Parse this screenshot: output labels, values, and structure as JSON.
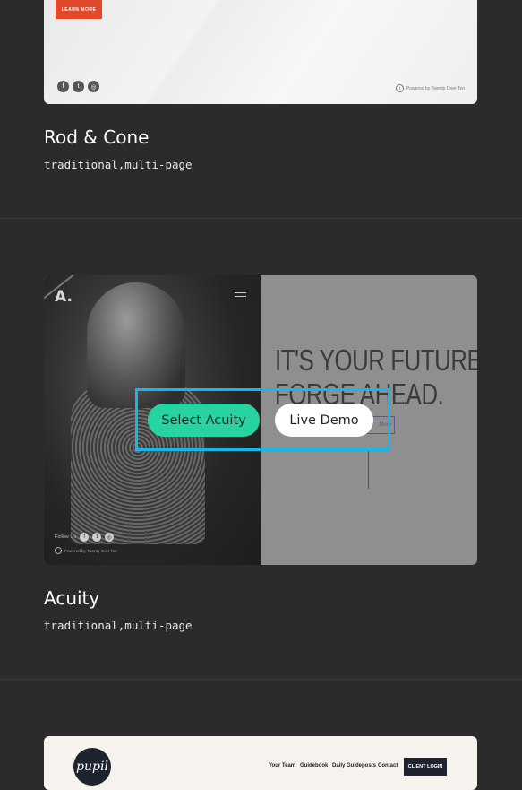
{
  "cards": [
    {
      "title": "Rod & Cone",
      "tags": "traditional,multi-page",
      "preview": {
        "button_label": "LEARN MORE",
        "social_icons": [
          "facebook-icon",
          "twitter-icon",
          "instagram-icon"
        ],
        "social_glyphs": [
          "f",
          "t",
          "◎"
        ],
        "powered_by": "Powered by Twenty Over Ten"
      }
    },
    {
      "title": "Acuity",
      "tags": "traditional,multi-page",
      "preview": {
        "logo": "A.",
        "headline_line1": "IT'S YOUR FUTURE.",
        "headline_line2": "FORGE AHEAD.",
        "learn_more": "More",
        "follow_us": "Follow Us",
        "social_glyphs": [
          "f",
          "t",
          "◎"
        ],
        "powered_by": "Powered by Twenty Over Ten"
      },
      "actions": {
        "select_label": "Select Acuity",
        "demo_label": "Live Demo"
      }
    },
    {
      "preview": {
        "logo": "pupil",
        "nav": [
          "Your Team",
          "Guidebook",
          "Daily Guideposts",
          "Contact"
        ],
        "client_login": "CLIENT LOGIN"
      }
    }
  ],
  "colors": {
    "background": "#2b2b2b",
    "select_button": "#27d3a0",
    "highlight_box": "#1cb6e6",
    "learn_more_button": "#e04a2a"
  }
}
